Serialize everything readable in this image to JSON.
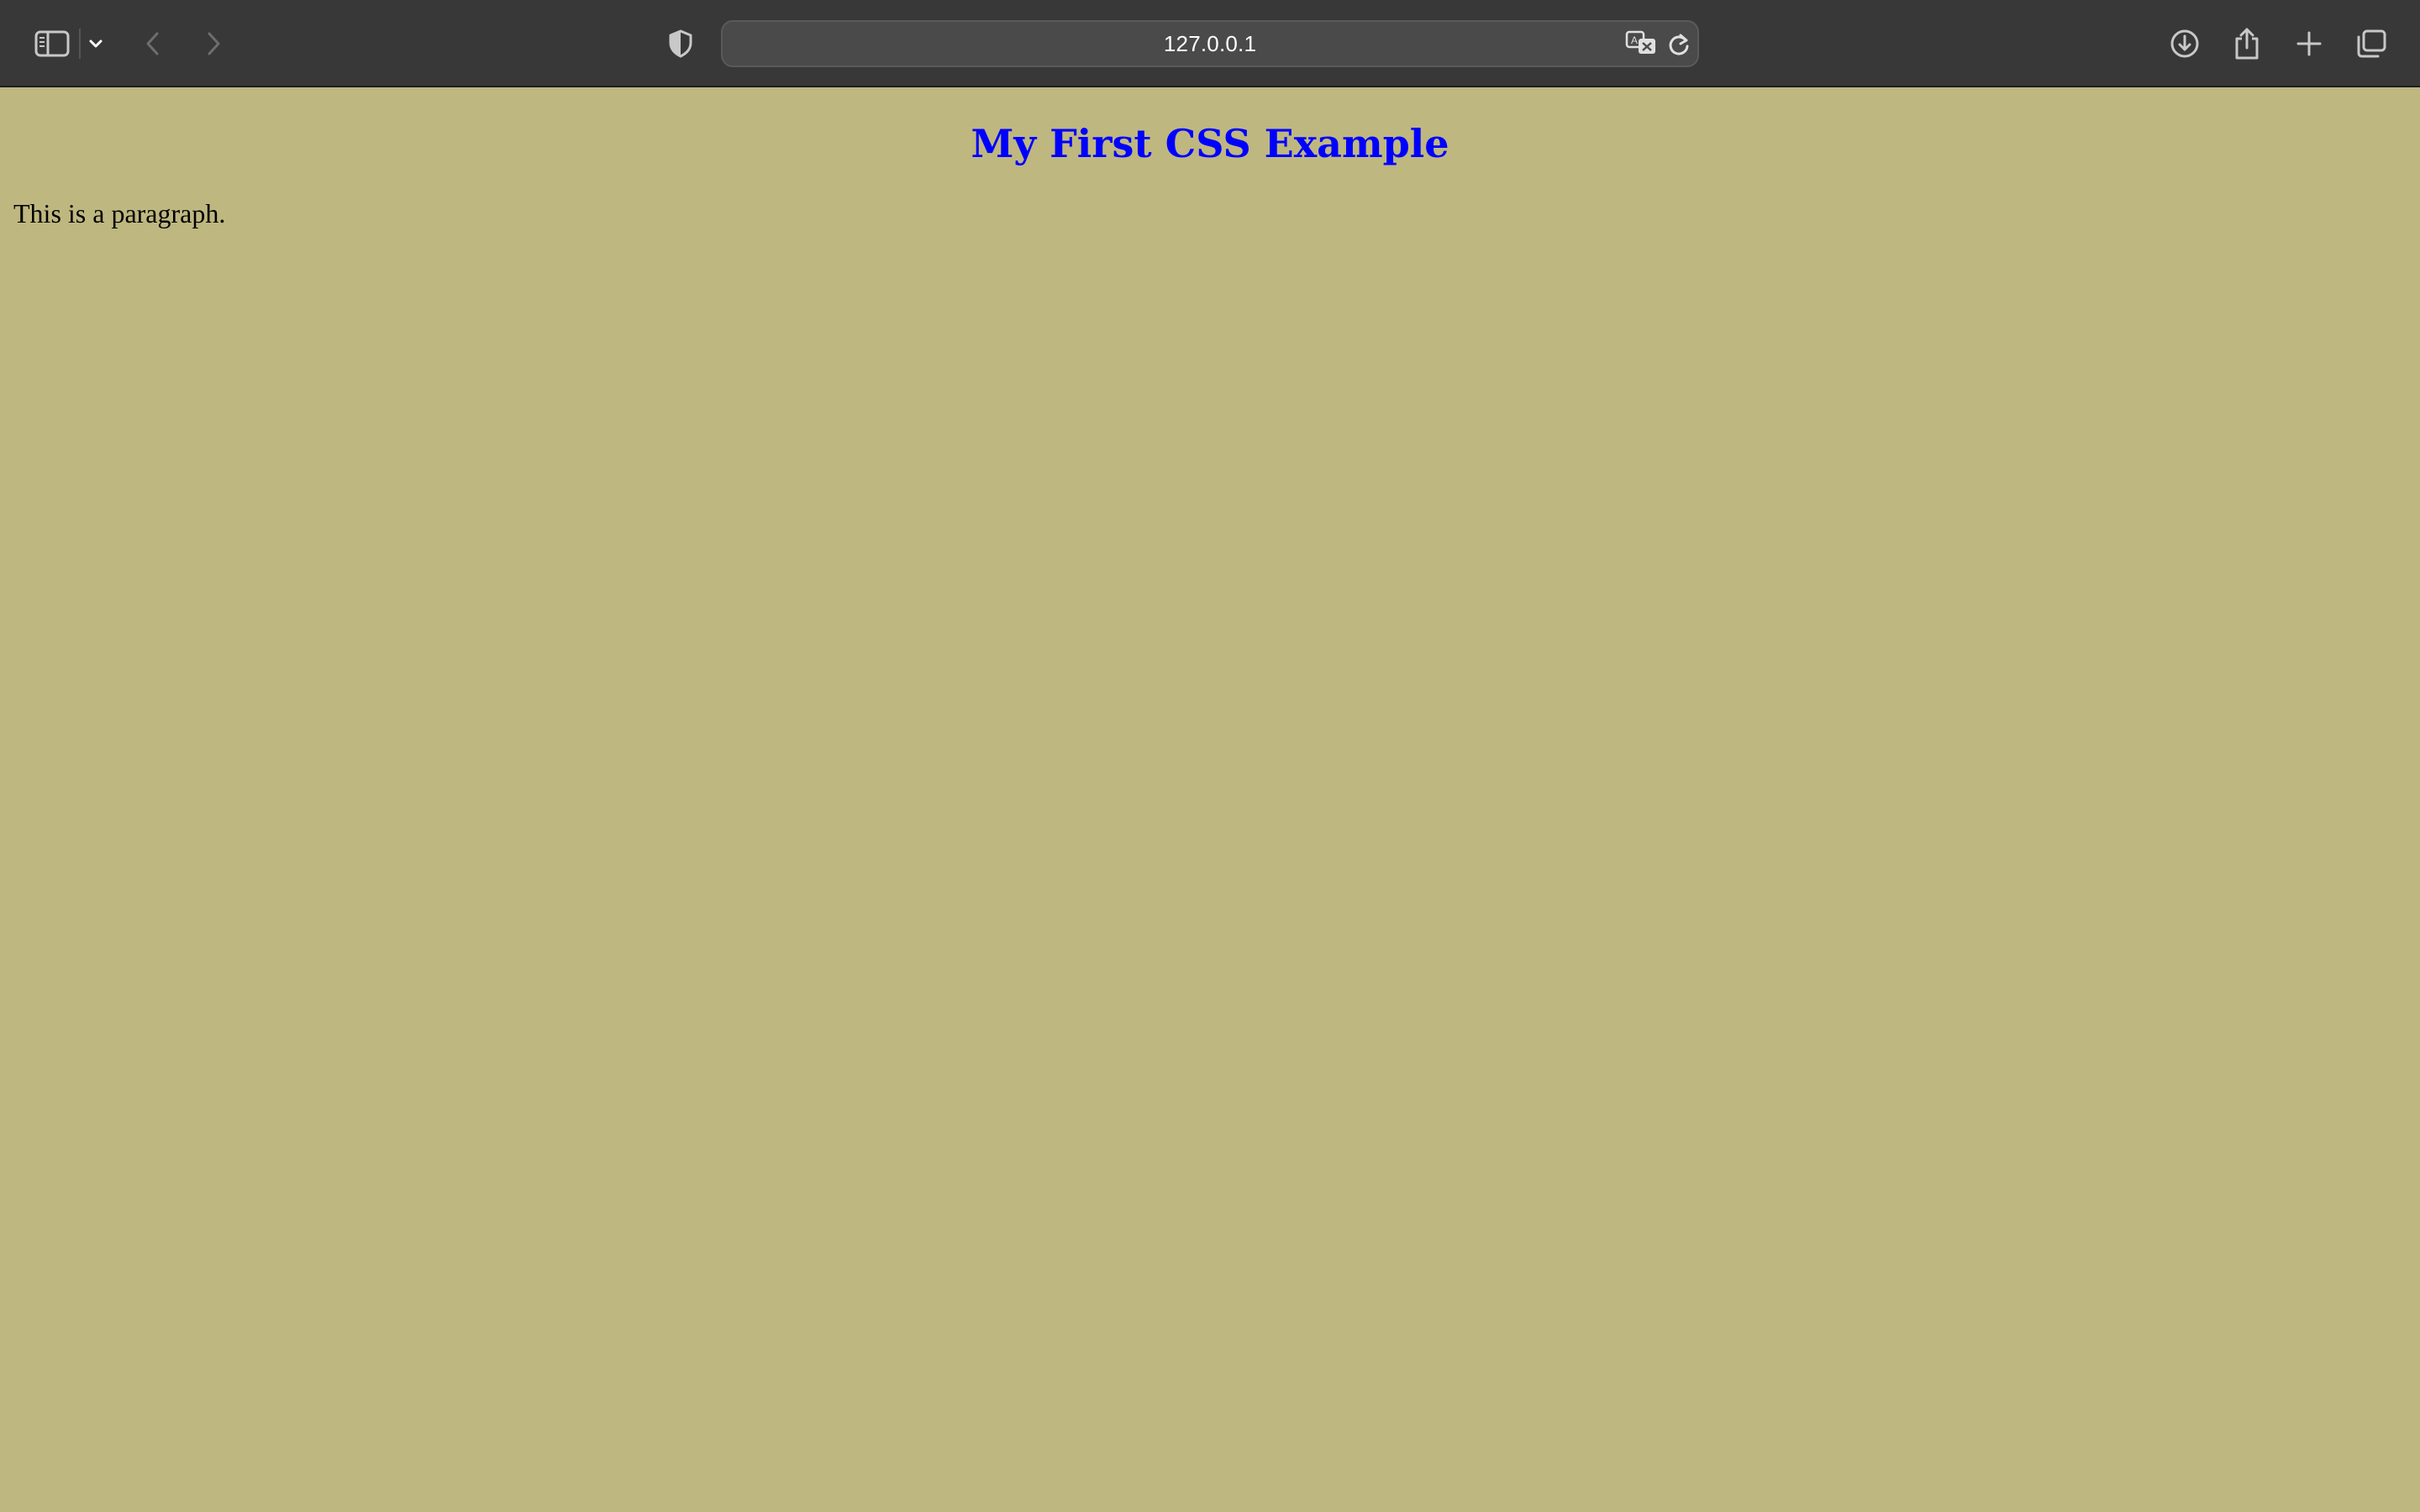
{
  "browser": {
    "address_bar": {
      "url": "127.0.0.1"
    },
    "colors": {
      "toolbar_bg": "#383838",
      "icon_color": "#c8c8c8",
      "icon_disabled": "#6e6e6e"
    },
    "icons": [
      "sidebar-icon",
      "chevron-down-icon",
      "back-arrow-icon",
      "forward-arrow-icon",
      "privacy-shield-icon",
      "translate-icon",
      "reload-icon",
      "download-icon",
      "share-icon",
      "new-tab-icon",
      "tab-overview-icon"
    ]
  },
  "page": {
    "background_color": "#bfb780",
    "heading": "My First CSS Example",
    "heading_color": "#0000ff",
    "paragraph": "This is a paragraph."
  }
}
